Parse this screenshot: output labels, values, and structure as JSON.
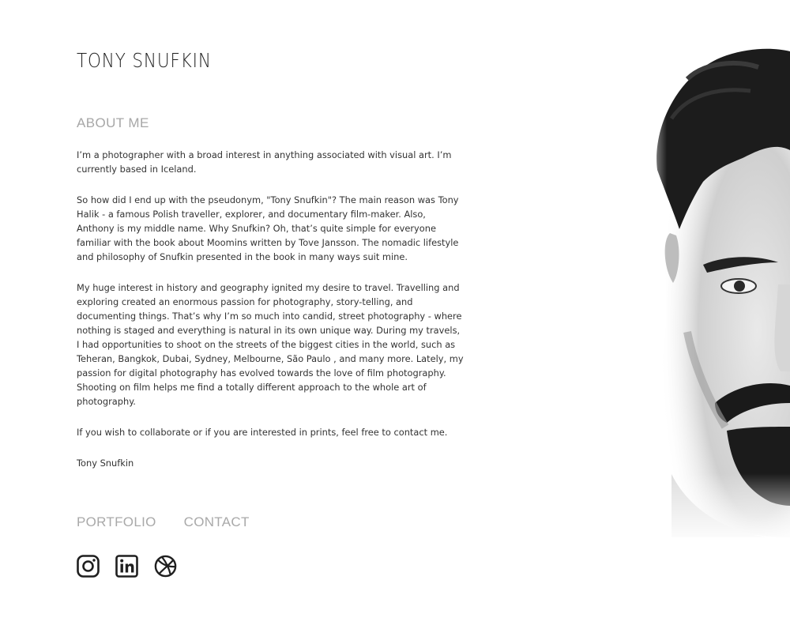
{
  "header": {
    "site_title": "TONY SNUFKIN"
  },
  "about": {
    "heading": "ABOUT ME",
    "paragraphs": [
      "I’m a photographer with a broad interest in anything associated with visual art. I’m currently based in Iceland.",
      "So how did I end up with the pseudonym, \"Tony Snufkin\"? The main reason was Tony Halik - a famous Polish traveller, explorer, and documentary film-maker. Also, Anthony is my middle name. Why Snufkin? Oh, that’s quite simple for everyone familiar with the book about Moomins written by Tove Jansson. The nomadic lifestyle and philosophy of Snufkin presented in the book in many ways suit mine.",
      " My huge interest in history and geography ignited my desire to travel. Travelling and exploring created an enormous passion for photography, story-telling, and documenting things. That’s why I’m so much into candid, street photography - where nothing is staged and everything is natural in its own unique way. During my travels, I had opportunities to shoot on the streets of the biggest cities in the world, such as Teheran, Bangkok, Dubai, Sydney, Melbourne,  São Paulo , and many more. Lately, my passion for digital photography has evolved towards the love of film photography. Shooting on film helps me find a totally different approach to the whole art of photography.",
      " If you wish to collaborate or if you are interested in prints, feel free to contact me.",
      "Tony Snufkin"
    ]
  },
  "nav": {
    "portfolio_label": "PORTFOLIO",
    "contact_label": "CONTACT"
  },
  "social": {
    "icons": [
      "instagram-icon",
      "linkedin-icon",
      "dribbble-icon"
    ],
    "icon_color": "#1f1f1f"
  },
  "portrait": {
    "icon": "portrait-photo"
  },
  "colors": {
    "background": "#ffffff",
    "text": "#333333",
    "muted": "#a9a9a9"
  }
}
